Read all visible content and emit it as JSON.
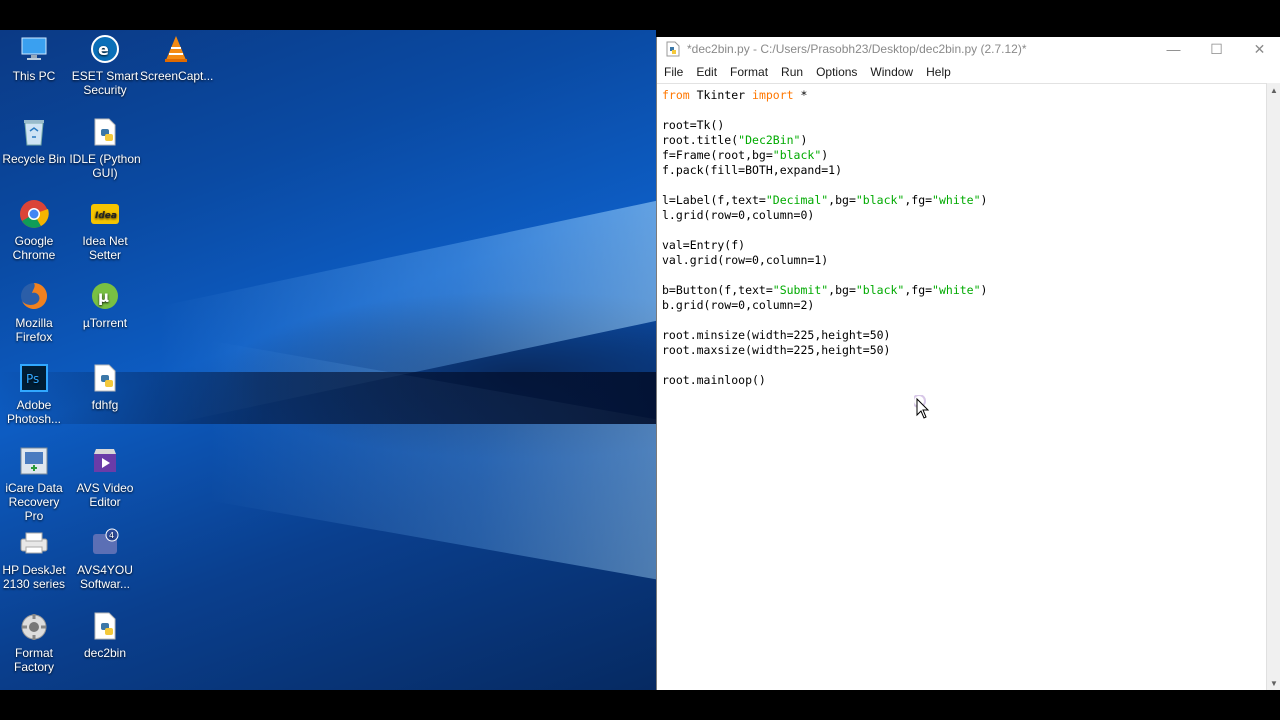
{
  "desktop": {
    "icons": [
      {
        "label": "This PC",
        "icon": "this-pc-icon"
      },
      {
        "label": "ESET Smart Security",
        "icon": "eset-icon"
      },
      {
        "label": "ScreenCapt...",
        "icon": "vlc-icon"
      },
      {
        "label": "Recycle Bin",
        "icon": "recycle-bin-icon"
      },
      {
        "label": "IDLE (Python GUI)",
        "icon": "python-idle-icon"
      },
      {
        "label": "Google Chrome",
        "icon": "chrome-icon"
      },
      {
        "label": "Idea Net Setter",
        "icon": "idea-icon"
      },
      {
        "label": "Mozilla Firefox",
        "icon": "firefox-icon"
      },
      {
        "label": "µTorrent",
        "icon": "utorrent-icon"
      },
      {
        "label": "Adobe Photosh...",
        "icon": "photoshop-icon"
      },
      {
        "label": "fdhfg",
        "icon": "python-file-icon"
      },
      {
        "label": "iCare Data Recovery Pro",
        "icon": "icare-icon"
      },
      {
        "label": "AVS Video Editor",
        "icon": "avs-video-icon"
      },
      {
        "label": "HP DeskJet 2130 series",
        "icon": "printer-icon"
      },
      {
        "label": "AVS4YOU Softwar...",
        "icon": "avs4you-icon"
      },
      {
        "label": "Format Factory",
        "icon": "format-factory-icon"
      },
      {
        "label": "dec2bin",
        "icon": "python-file-icon"
      }
    ]
  },
  "editor": {
    "title": "*dec2bin.py - C:/Users/Prasobh23/Desktop/dec2bin.py (2.7.12)*",
    "controls": {
      "minimize": "—",
      "maximize": "☐",
      "close": "✕"
    },
    "menu": [
      "File",
      "Edit",
      "Format",
      "Run",
      "Options",
      "Window",
      "Help"
    ],
    "code": [
      [
        {
          "t": "from",
          "c": "kw"
        },
        {
          "t": " Tkinter ",
          "c": ""
        },
        {
          "t": "import",
          "c": "kw"
        },
        {
          "t": " *",
          "c": ""
        }
      ],
      [],
      [
        {
          "t": "root=Tk()",
          "c": ""
        }
      ],
      [
        {
          "t": "root.title(",
          "c": ""
        },
        {
          "t": "\"Dec2Bin\"",
          "c": "str"
        },
        {
          "t": ")",
          "c": ""
        }
      ],
      [
        {
          "t": "f=Frame(root,bg=",
          "c": ""
        },
        {
          "t": "\"black\"",
          "c": "str"
        },
        {
          "t": ")",
          "c": ""
        }
      ],
      [
        {
          "t": "f.pack(fill=BOTH,expand=1)",
          "c": ""
        }
      ],
      [],
      [
        {
          "t": "l=Label(f,text=",
          "c": ""
        },
        {
          "t": "\"Decimal\"",
          "c": "str"
        },
        {
          "t": ",bg=",
          "c": ""
        },
        {
          "t": "\"black\"",
          "c": "str"
        },
        {
          "t": ",fg=",
          "c": ""
        },
        {
          "t": "\"white\"",
          "c": "str"
        },
        {
          "t": ")",
          "c": ""
        }
      ],
      [
        {
          "t": "l.grid(row=0,column=0)",
          "c": ""
        }
      ],
      [],
      [
        {
          "t": "val=Entry(f)",
          "c": ""
        }
      ],
      [
        {
          "t": "val.grid(row=0,column=1)",
          "c": ""
        }
      ],
      [],
      [
        {
          "t": "b=Button(f,text=",
          "c": ""
        },
        {
          "t": "\"Submit\"",
          "c": "str"
        },
        {
          "t": ",bg=",
          "c": ""
        },
        {
          "t": "\"black\"",
          "c": "str"
        },
        {
          "t": ",fg=",
          "c": ""
        },
        {
          "t": "\"white\"",
          "c": "str"
        },
        {
          "t": ")",
          "c": ""
        }
      ],
      [
        {
          "t": "b.grid(row=0,column=2)",
          "c": ""
        }
      ],
      [],
      [
        {
          "t": "root.minsize(width=225,height=50)",
          "c": ""
        }
      ],
      [
        {
          "t": "root.maxsize(width=225,height=50)",
          "c": ""
        }
      ],
      [],
      [
        {
          "t": "root.mainloop()",
          "c": ""
        }
      ]
    ]
  },
  "colors": {
    "keyword": "#ff7700",
    "string": "#00aa00",
    "desktop_blue": "#0a4aa3"
  }
}
